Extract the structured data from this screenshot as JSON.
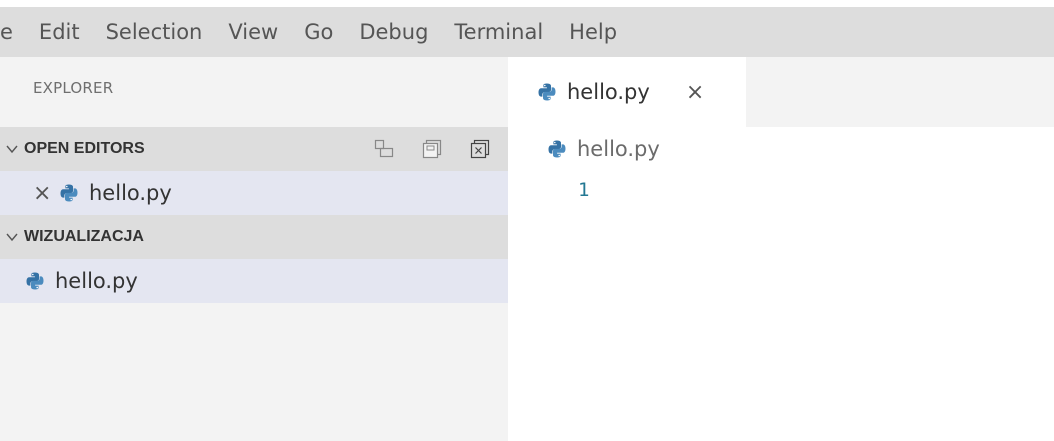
{
  "menu": {
    "items": [
      "e",
      "Edit",
      "Selection",
      "View",
      "Go",
      "Debug",
      "Terminal",
      "Help"
    ]
  },
  "sidebar": {
    "title": "EXPLORER",
    "open_editors": {
      "chevron": "✓",
      "label": "OPEN EDITORS",
      "actions": [
        "new-untitled-file-icon",
        "save-all-icon",
        "close-all-editors-icon"
      ],
      "files": [
        {
          "close": "×",
          "name": "hello.py",
          "icon": "python-file-icon"
        }
      ]
    },
    "folder": {
      "chevron": "✓",
      "label": "WIZUALIZACJA",
      "files": [
        {
          "name": "hello.py",
          "icon": "python-file-icon"
        }
      ]
    }
  },
  "editor": {
    "tab": {
      "name": "hello.py",
      "close": "×",
      "icon": "python-file-icon"
    },
    "breadcrumb": {
      "name": "hello.py",
      "icon": "python-file-icon"
    },
    "line_numbers": [
      "1"
    ]
  },
  "colors": {
    "menubar_bg": "#dddddd",
    "sidebar_bg": "#f3f3f3",
    "section_header_bg": "#dddddd",
    "selected_row_bg": "#e4e6f1",
    "line_number": "#237893",
    "python_blue": "#3572a5",
    "python_yellow": "#ffd43b"
  }
}
